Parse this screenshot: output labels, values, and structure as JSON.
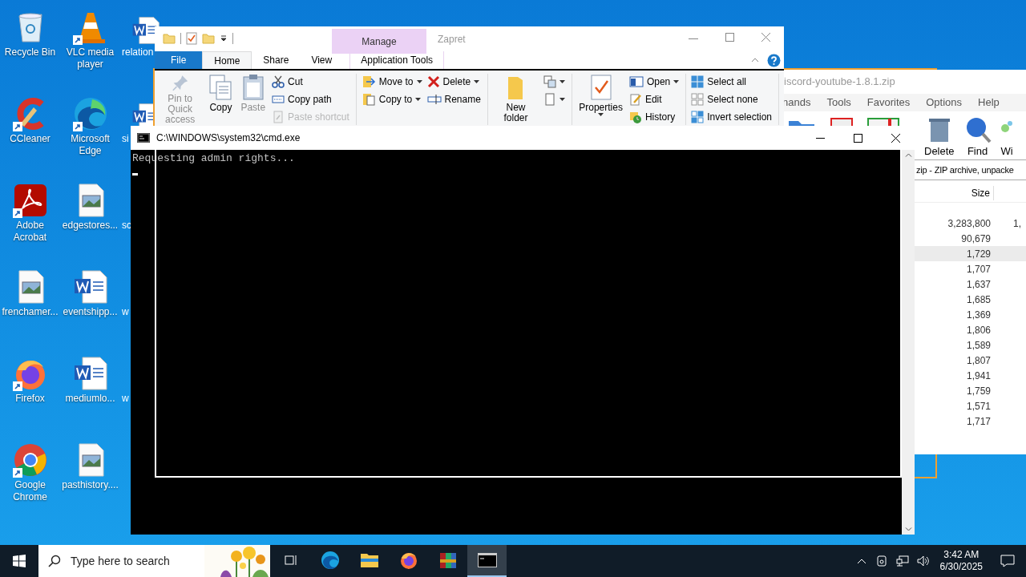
{
  "desktop": {
    "columns": [
      [
        {
          "label": "Recycle Bin",
          "shortcut": false
        },
        {
          "label": "CCleaner",
          "shortcut": true
        },
        {
          "label": "Adobe Acrobat",
          "shortcut": true
        },
        {
          "label": "frenchamer...",
          "shortcut": false
        },
        {
          "label": "Firefox",
          "shortcut": true
        },
        {
          "label": "Google Chrome",
          "shortcut": true
        }
      ],
      [
        {
          "label": "VLC media player",
          "shortcut": true
        },
        {
          "label": "Microsoft Edge",
          "shortcut": true
        },
        {
          "label": "edgestores...",
          "shortcut": false
        },
        {
          "label": "eventshipp...",
          "shortcut": false
        },
        {
          "label": "mediumlo...",
          "shortcut": false
        },
        {
          "label": "pasthistory....",
          "shortcut": false
        }
      ],
      [
        {
          "label": "relation",
          "shortcut": false
        },
        {
          "label": "si",
          "shortcut": false
        },
        {
          "label": "sc",
          "shortcut": false
        },
        {
          "label": "w",
          "shortcut": false
        },
        {
          "label": "w",
          "shortcut": false
        }
      ]
    ]
  },
  "winrar": {
    "title": "iscord-youtube-1.8.1.zip",
    "menu": [
      "nands",
      "Tools",
      "Favorites",
      "Options",
      "Help"
    ],
    "toolbar": [
      "Delete",
      "Find",
      "Wi"
    ],
    "path": "zip - ZIP archive, unpacke",
    "columns": [
      "Size"
    ],
    "rows": [
      {
        "size": "3,283,800",
        "column_2": "1,",
        "selected": false
      },
      {
        "size": "90,679",
        "selected": false
      },
      {
        "size": "1,729",
        "selected": true
      },
      {
        "size": "1,707",
        "selected": false
      },
      {
        "size": "1,637",
        "selected": false
      },
      {
        "size": "1,685",
        "selected": false
      },
      {
        "size": "1,369",
        "selected": false
      },
      {
        "size": "1,806",
        "selected": false
      },
      {
        "size": "1,589",
        "selected": false
      },
      {
        "size": "1,807",
        "selected": false
      },
      {
        "size": "1,941",
        "selected": false
      },
      {
        "size": "1,759",
        "selected": false
      },
      {
        "size": "1,571",
        "selected": false
      },
      {
        "size": "1,717",
        "selected": false
      }
    ]
  },
  "explorer": {
    "title": "Zapret",
    "context_tab": "Manage",
    "tabs": [
      {
        "label": "File",
        "selected": false
      },
      {
        "label": "Home",
        "selected": true
      },
      {
        "label": "Share",
        "selected": false
      },
      {
        "label": "View",
        "selected": false
      },
      {
        "label": "Application Tools",
        "selected": false
      }
    ],
    "ribbon": [
      [
        {
          "kind": "large",
          "items": [
            {
              "label": "Pin to Quick access",
              "disabled": true,
              "dropdown": false
            }
          ]
        },
        {
          "kind": "large",
          "items": [
            {
              "label": "Copy",
              "disabled": false,
              "dropdown": false
            }
          ]
        },
        {
          "kind": "large",
          "items": [
            {
              "label": "Paste",
              "disabled": true,
              "dropdown": false
            }
          ]
        },
        {
          "kind": "stack",
          "items": [
            {
              "label": "Cut",
              "disabled": false,
              "dropdown": false
            },
            {
              "label": "Copy path",
              "disabled": false,
              "dropdown": false
            },
            {
              "label": "Paste shortcut",
              "disabled": true,
              "dropdown": false
            }
          ]
        }
      ],
      [
        {
          "kind": "stack",
          "items": [
            {
              "label": "Move to",
              "disabled": false,
              "dropdown": true
            },
            {
              "label": "Copy to",
              "disabled": false,
              "dropdown": true
            }
          ]
        },
        {
          "kind": "stack",
          "items": [
            {
              "label": "Delete",
              "disabled": false,
              "dropdown": true
            },
            {
              "label": "Rename",
              "disabled": false,
              "dropdown": false
            }
          ]
        }
      ],
      [
        {
          "kind": "large",
          "items": [
            {
              "label": "New folder",
              "disabled": false,
              "dropdown": false
            }
          ]
        },
        {
          "kind": "stack",
          "items": [
            {
              "disabled": false,
              "dropdown": true
            },
            {
              "disabled": false,
              "dropdown": true
            }
          ]
        }
      ],
      [
        {
          "kind": "large",
          "items": [
            {
              "label": "Properties",
              "disabled": false,
              "dropdown": true
            }
          ]
        },
        {
          "kind": "stack",
          "items": [
            {
              "label": "Open",
              "disabled": false,
              "dropdown": true
            },
            {
              "label": "Edit",
              "disabled": false,
              "dropdown": false
            },
            {
              "label": "History",
              "disabled": false,
              "dropdown": false
            }
          ]
        }
      ],
      [
        {
          "kind": "stack",
          "items": [
            {
              "label": "Select all",
              "disabled": false,
              "dropdown": false
            },
            {
              "label": "Select none",
              "disabled": false,
              "dropdown": false
            },
            {
              "label": "Invert selection",
              "disabled": false,
              "dropdown": false
            }
          ]
        }
      ]
    ]
  },
  "cmd": {
    "title": "C:\\WINDOWS\\system32\\cmd.exe",
    "lines": [
      "Requesting admin rights..."
    ]
  },
  "taskbar": {
    "search_placeholder": "Type here to search",
    "apps": [
      {
        "selected": false
      },
      {
        "selected": false
      },
      {
        "selected": false
      },
      {
        "selected": false
      },
      {
        "selected": false
      },
      {
        "selected": true
      }
    ],
    "time": "3:42 AM",
    "date": "6/30/2025"
  }
}
